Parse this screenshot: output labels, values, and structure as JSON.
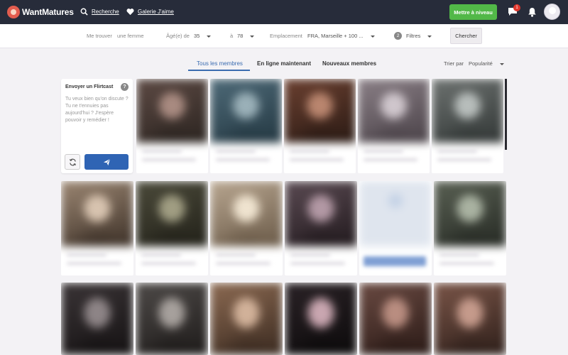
{
  "header": {
    "logo_text": "WantMatures",
    "nav": [
      {
        "label": "Recherche",
        "icon": "search-icon"
      },
      {
        "label": "Galerie J'aime",
        "icon": "heart-icon"
      }
    ],
    "upgrade_label": "Mettre à niveau",
    "messages_badge": "1",
    "colors": {
      "bar": "#272c3a",
      "upgrade": "#52b848",
      "badge": "#e0362c"
    }
  },
  "search": {
    "find_me_label": "Me trouver",
    "find_me_value": "une femme",
    "age_from_label": "Âgé(e) de",
    "age_from_value": "35",
    "age_to_label": "à",
    "age_to_value": "78",
    "location_label": "Emplacement",
    "location_value": "FRA, Marseille + 100 ...",
    "filters_count": "2",
    "filters_label": "Filtres",
    "search_button": "Chercher"
  },
  "tabs": [
    {
      "label": "Tous les membres",
      "active": true
    },
    {
      "label": "En ligne maintenant",
      "active": false
    },
    {
      "label": "Nouveaux membres",
      "active": false
    }
  ],
  "sort": {
    "label": "Trier par",
    "value": "Popularité"
  },
  "flirtcast": {
    "title": "Envoyer un Flirtcast",
    "message": "Tu veux bien qu'on discute ? Tu ne t'ennuies pas aujourd'hui ? J'espère pouvoir y remédier !"
  },
  "accent_color": "#3b6db0"
}
